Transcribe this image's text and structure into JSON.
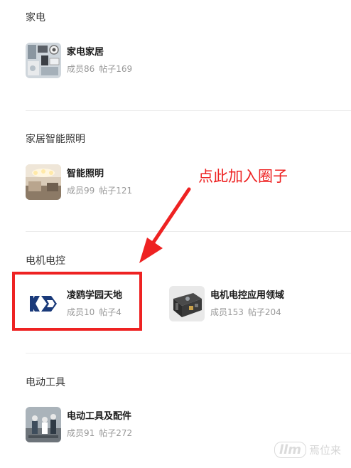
{
  "sections": [
    {
      "title": "家电",
      "groups": [
        {
          "name": "家电家居",
          "members_label": "成员86",
          "posts_label": "帖子169",
          "thumb_icon": "appliance-photo-icon"
        }
      ]
    },
    {
      "title": "家居智能照明",
      "groups": [
        {
          "name": "智能照明",
          "members_label": "成员99",
          "posts_label": "帖子121",
          "thumb_icon": "chandelier-photo-icon"
        }
      ]
    },
    {
      "title": "电机电控",
      "groups": [
        {
          "name": "凌鸥学园天地",
          "members_label": "成员10",
          "posts_label": "帖子4",
          "thumb_icon": "lk-logo-icon"
        },
        {
          "name": "电机电控应用领域",
          "members_label": "成员153",
          "posts_label": "帖子204",
          "thumb_icon": "circuit-board-photo-icon"
        }
      ]
    },
    {
      "title": "电动工具",
      "groups": [
        {
          "name": "电动工具及配件",
          "members_label": "成员91",
          "posts_label": "帖子272",
          "thumb_icon": "workers-photo-icon"
        }
      ]
    }
  ],
  "annotation": {
    "text": "点此加入圈子",
    "color": "#ee2222"
  },
  "watermark": {
    "mark": "llm",
    "text": "焉位来"
  }
}
